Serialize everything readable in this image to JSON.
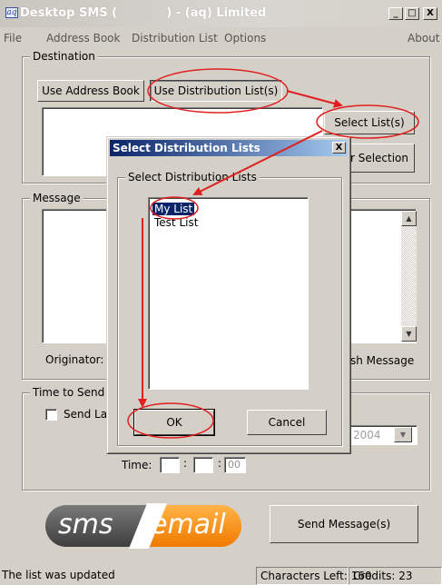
{
  "window": {
    "title": "Desktop SMS (            ) - (aq) Limited",
    "min_glyph": "_",
    "max_glyph": "□",
    "close_glyph": "X"
  },
  "menu": {
    "file": "File",
    "address_book": "Address Book",
    "distribution_list": "Distribution List",
    "options": "Options",
    "about": "About"
  },
  "destination": {
    "group_label": "Destination",
    "use_address_book": "Use Address Book",
    "use_distribution_lists": "Use Distribution List(s)",
    "select_lists": "Select List(s)",
    "clear_selection_partial": "ar Selection"
  },
  "message": {
    "group_label": "Message",
    "originator_label": "Originator:",
    "flash_message_partial": "sh Message"
  },
  "time_to_send": {
    "group_label": "Time to Send",
    "send_later_partial": "Send La",
    "date_year_partial": "2004",
    "time_label": "Time:",
    "time_minutes": "00"
  },
  "send_button": "Send Message(s)",
  "logo": {
    "left": "sms",
    "right": "email"
  },
  "status": {
    "message": "The list was updated",
    "characters_left": "Characters Left: 160",
    "credits": "Credits: 23"
  },
  "dialog": {
    "title": "Select Distribution Lists",
    "close_glyph": "X",
    "group_label": "Select Distribution Lists",
    "lists": [
      "My List",
      "Test List"
    ],
    "selected_index": 0,
    "ok": "OK",
    "cancel": "Cancel"
  },
  "annotation_color": "#e02020"
}
